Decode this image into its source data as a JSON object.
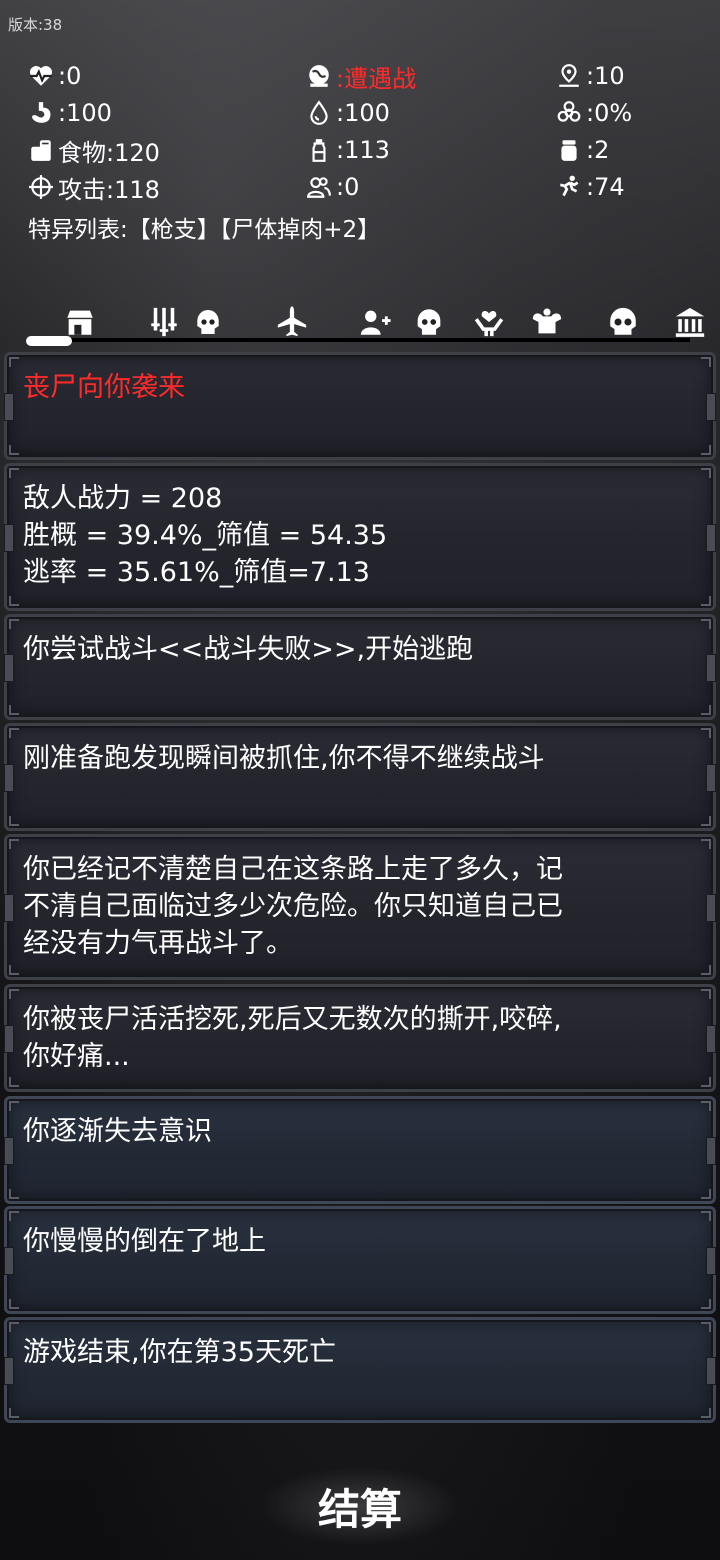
{
  "version": "版本:38",
  "stats": {
    "health": ":0",
    "event": ":遭遇战",
    "location": ":10",
    "hunger": ":100",
    "water": ":100",
    "infection": ":0%",
    "food": "食物:120",
    "drink": ":113",
    "ammo": ":2",
    "attack": "攻击:118",
    "companions": ":0",
    "speed": ":74"
  },
  "traits": "特异列表:【枪支】【尸体掉肉+2】",
  "tabs": [
    "shop-icon",
    "weapons-icon",
    "skull-icon",
    "plane-icon",
    "add-person-icon",
    "skull-icon",
    "heal-icon",
    "strength-icon",
    "skull-icon",
    "bank-icon"
  ],
  "logs": [
    {
      "text": "丧尸向你袭来",
      "color": "#ff2b2b"
    },
    {
      "text": "敌人战力 = 208\n胜概 = 39.4%_筛值 = 54.35\n逃率 = 35.61%_筛值=7.13"
    },
    {
      "text": "你尝试战斗<<战斗失败>>,开始逃跑"
    },
    {
      "text": "刚准备跑发现瞬间被抓住,你不得不继续战斗"
    },
    {
      "text": "你已经记不清楚自己在这条路上走了多久，记\n不清自己面临过多少次危险。你只知道自己已\n经没有力气再战斗了。"
    },
    {
      "text": "你被丧尸活活挖死,死后又无数次的撕开,咬碎,\n你好痛..."
    },
    {
      "text": "你逐渐失去意识"
    },
    {
      "text": "你慢慢的倒在了地上"
    },
    {
      "text": "游戏结束,你在第35天死亡"
    }
  ],
  "settle_label": "结算",
  "colors": {
    "alert": "#ff2b2b",
    "text": "#ffffff"
  }
}
